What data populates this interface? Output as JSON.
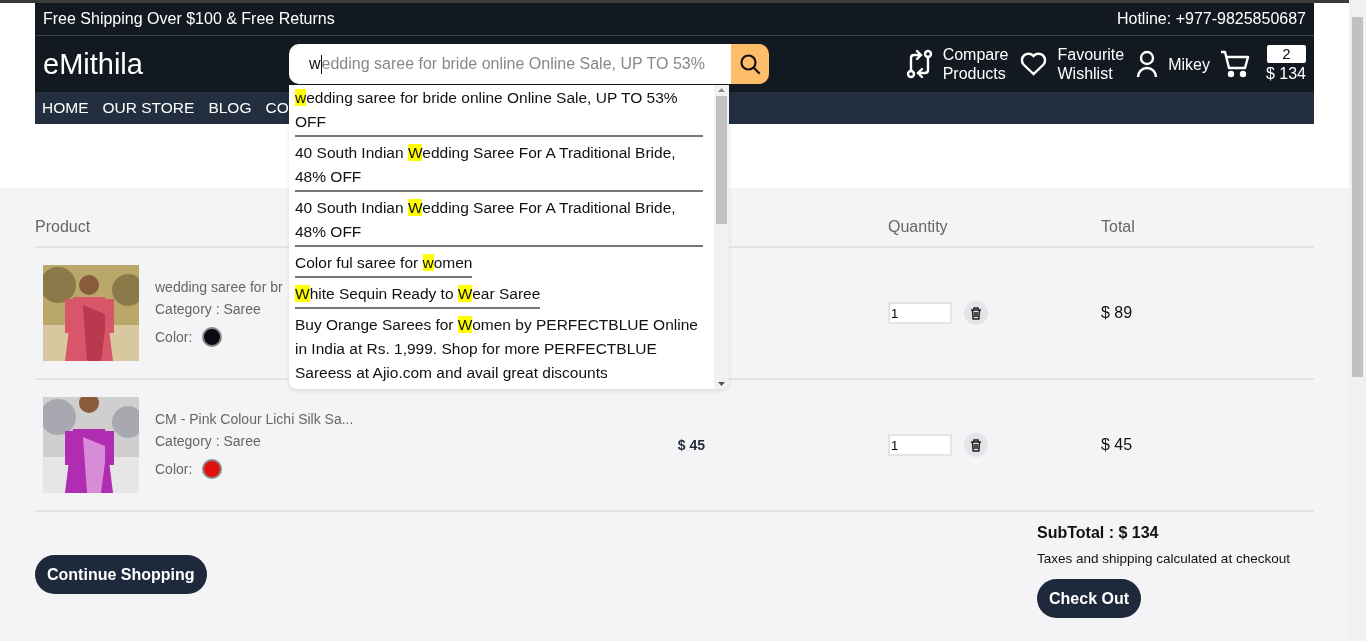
{
  "topbar": {
    "promo": "Free Shipping Over $100 & Free Returns",
    "hotline": "Hotline: +977-9825850687"
  },
  "logo": "eMithila",
  "search": {
    "value": "w",
    "completion": "edding saree for bride online Online Sale, UP TO 53%",
    "suggestions": [
      {
        "parts": [
          {
            "text": "w",
            "highlight": true
          },
          {
            "text": "edding saree for bride online Online Sale, UP TO 53% OFF",
            "highlight": false
          }
        ]
      },
      {
        "parts": [
          {
            "text": "40 South Indian ",
            "highlight": false
          },
          {
            "text": "W",
            "highlight": true
          },
          {
            "text": "edding Saree For A Traditional Bride, 48% OFF",
            "highlight": false
          }
        ]
      },
      {
        "parts": [
          {
            "text": "40 South Indian ",
            "highlight": false
          },
          {
            "text": "W",
            "highlight": true
          },
          {
            "text": "edding Saree For A Traditional Bride, 48% OFF",
            "highlight": false
          }
        ]
      },
      {
        "parts": [
          {
            "text": "Color ful saree for ",
            "highlight": false
          },
          {
            "text": "w",
            "highlight": true
          },
          {
            "text": "omen",
            "highlight": false
          }
        ]
      },
      {
        "parts": [
          {
            "text": "W",
            "highlight": true
          },
          {
            "text": "hite Sequin Ready to ",
            "highlight": false
          },
          {
            "text": "W",
            "highlight": true
          },
          {
            "text": "ear Saree",
            "highlight": false
          }
        ]
      },
      {
        "parts": [
          {
            "text": "Buy Orange Sarees for ",
            "highlight": false
          },
          {
            "text": "W",
            "highlight": true
          },
          {
            "text": "omen by PERFECTBLUE Online in India at Rs. 1,999. Shop for more PERFECTBLUE Sareess at Ajio.com and avail great discounts",
            "highlight": false
          }
        ]
      }
    ]
  },
  "header_links": [
    {
      "kind": "compare",
      "lines": [
        "Compare",
        "Products"
      ]
    },
    {
      "kind": "wishlist",
      "lines": [
        "Favourite",
        "Wishlist"
      ]
    },
    {
      "kind": "user",
      "lines": [
        "Mikey"
      ]
    }
  ],
  "cart": {
    "count": "2",
    "total": "$ 134"
  },
  "nav": [
    {
      "label": "HOME"
    },
    {
      "label": "OUR STORE"
    },
    {
      "label": "BLOG"
    },
    {
      "label": "CO"
    }
  ],
  "table": {
    "columns": [
      {
        "kind": "product",
        "label": "Product"
      },
      {
        "kind": "quantity",
        "label": "Quantity"
      },
      {
        "kind": "total",
        "label": "Total"
      }
    ],
    "rows": [
      {
        "name": "wedding saree for br",
        "category": "Category : Saree",
        "color_label": "Color:",
        "color": "#0b0b16",
        "quantity": "1",
        "total": "$ 89"
      },
      {
        "name": "CM - Pink Colour Lichi Silk Sa...",
        "category": "Category : Saree",
        "color_label": "Color:",
        "color": "#e01010",
        "price": "$ 45",
        "quantity": "1",
        "total": "$ 45"
      }
    ]
  },
  "continue_button": "Continue Shopping",
  "summary": {
    "subtotal": "SubTotal : $ 134",
    "note": "Taxes and shipping calculated at checkout",
    "checkout_button": "Check Out"
  }
}
